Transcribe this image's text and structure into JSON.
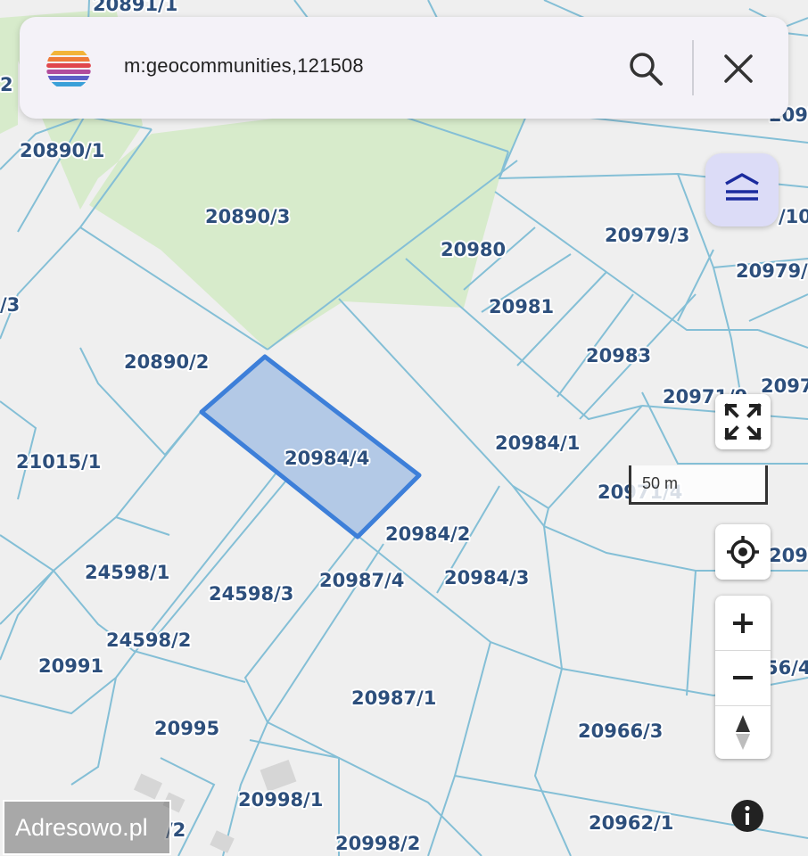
{
  "search": {
    "query": "m:geocommunities,121508"
  },
  "controls": {
    "search_icon": "magnifier-icon",
    "close_icon": "close-icon",
    "layers_icon": "layers-icon",
    "fullscreen_icon": "fullscreen-icon",
    "locate_icon": "crosshair-icon",
    "zoom_in_label": "+",
    "zoom_out_label": "−",
    "compass_icon": "north-arrow-icon",
    "info_icon": "info-icon"
  },
  "scale_bar": {
    "label": "50 m"
  },
  "watermark": {
    "text": "Adresowo.pl"
  },
  "selected_parcel": "20984/4",
  "parcels": [
    "20891/1",
    "20890/1",
    "20890/3",
    "20980",
    "20979/3",
    "20979/",
    "20981",
    "20983",
    "20890/2",
    "20984/4",
    "20984/1",
    "21015/1",
    "20971/9",
    "20971/4",
    "20984/2",
    "24598/1",
    "24598/3",
    "20987/4",
    "20984/3",
    "24598/2",
    "20991",
    "20987/1",
    "20995",
    "20966/3",
    "20998/1",
    "20962/1",
    "20998/2",
    "2097",
    "/3",
    "2",
    "/2",
    "56/4",
    "/10",
    "20979/"
  ],
  "colors": {
    "land": "#efefef",
    "forest": "#d7ebcb",
    "boundary": "#84bfd6",
    "selected_fill": "#b3c9e6",
    "selected_stroke": "#3d7fd9",
    "label": "#2d4f7c",
    "layers_button": "#dcdcf7"
  }
}
